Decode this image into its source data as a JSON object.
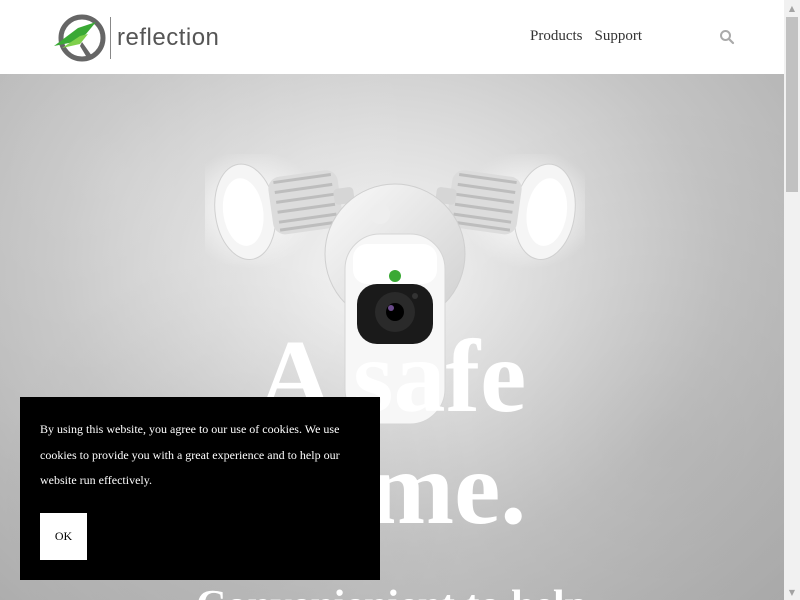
{
  "header": {
    "logo_text": "reflection",
    "nav": [
      {
        "label": "Products"
      },
      {
        "label": "Support"
      }
    ],
    "search_icon": "search-icon"
  },
  "hero": {
    "headline_line1": "A safe",
    "headline_line2": "home.",
    "subline": "Convenienient to help"
  },
  "cookie_banner": {
    "message": "By using this website, you agree to our use of cookies. We use cookies to provide you with a great experience and to help our website run effectively.",
    "ok_label": "OK"
  },
  "colors": {
    "brand_green": "#3aa935",
    "banner_bg": "#000000"
  }
}
